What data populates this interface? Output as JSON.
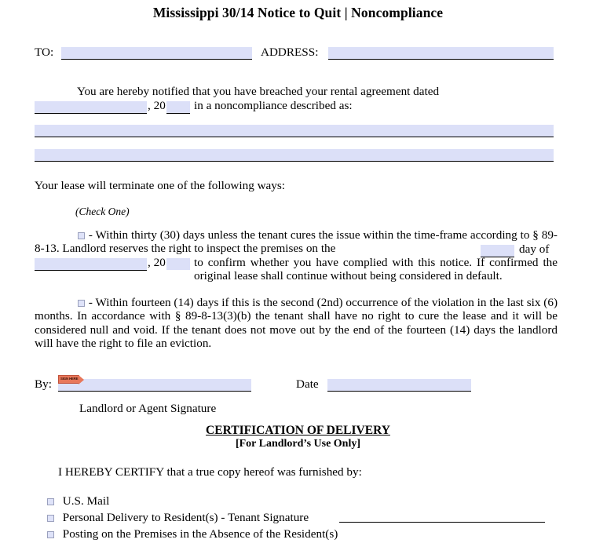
{
  "document": {
    "title": "Mississippi 30/14 Notice to Quit | Noncompliance"
  },
  "recipient_row": {
    "to_label": "TO:",
    "to_value": "",
    "address_label": "ADDRESS:",
    "address_value": ""
  },
  "intro": {
    "text_before_date": "You are hereby notified that you have breached your rental agreement dated",
    "month_value": "",
    "year_prefix": ", 20",
    "year_value": "",
    "text_after_date": "in a noncompliance described as:",
    "description_line_1": "",
    "description_line_2": ""
  },
  "terminate": {
    "lead_in": "Your lease will terminate one of the following ways:",
    "check_one": "(Check One)"
  },
  "option_thirty": {
    "checkbox_name": "thirty-day-checkbox",
    "checked": false,
    "part_1": "- Within thirty (30) days unless the tenant cures the issue within the time-frame according to § 89-8-13. Landlord reserves the right to inspect the premises on the",
    "day_value": "",
    "part_2": "day of",
    "month_value": "",
    "year_prefix": ", 20",
    "year_value": "",
    "part_3": "to confirm whether you have complied with this notice. If confirmed the original lease shall continue without being considered in default."
  },
  "option_fourteen": {
    "checkbox_name": "fourteen-day-checkbox",
    "checked": false,
    "text": "- Within fourteen (14) days if this is the second (2nd) occurrence of the violation in the last six (6) months. In accordance with § 89-8-13(3)(b) the tenant shall have no right to cure the lease and it will be considered null and void. If the tenant does not move out by the end of the fourteen (14) days the landlord will have the right to file an eviction."
  },
  "signature": {
    "by_label": "By:",
    "by_value": "",
    "date_label": "Date",
    "date_value": "",
    "caption": "Landlord or Agent Signature",
    "sign_marker_label": "SIGN HERE"
  },
  "certification": {
    "heading": "CERTIFICATION OF DELIVERY",
    "subheading": "[For Landlord’s Use Only]",
    "statement": "I HEREBY CERTIFY that a true copy hereof was furnished by:",
    "methods": [
      {
        "label": "U.S. Mail",
        "checked": false,
        "has_line": false
      },
      {
        "label": "Personal Delivery to Resident(s) - Tenant Signature",
        "checked": false,
        "has_line": true
      },
      {
        "label": "Posting on the Premises in the Absence of the Resident(s)",
        "checked": false,
        "has_line": false
      }
    ]
  },
  "colors": {
    "field_fill": "#dce0f8",
    "checkbox_fill": "#dfe3f9",
    "checkbox_border": "#9aa0bd",
    "marker_orange": "#e8775a",
    "text": "#000000"
  }
}
